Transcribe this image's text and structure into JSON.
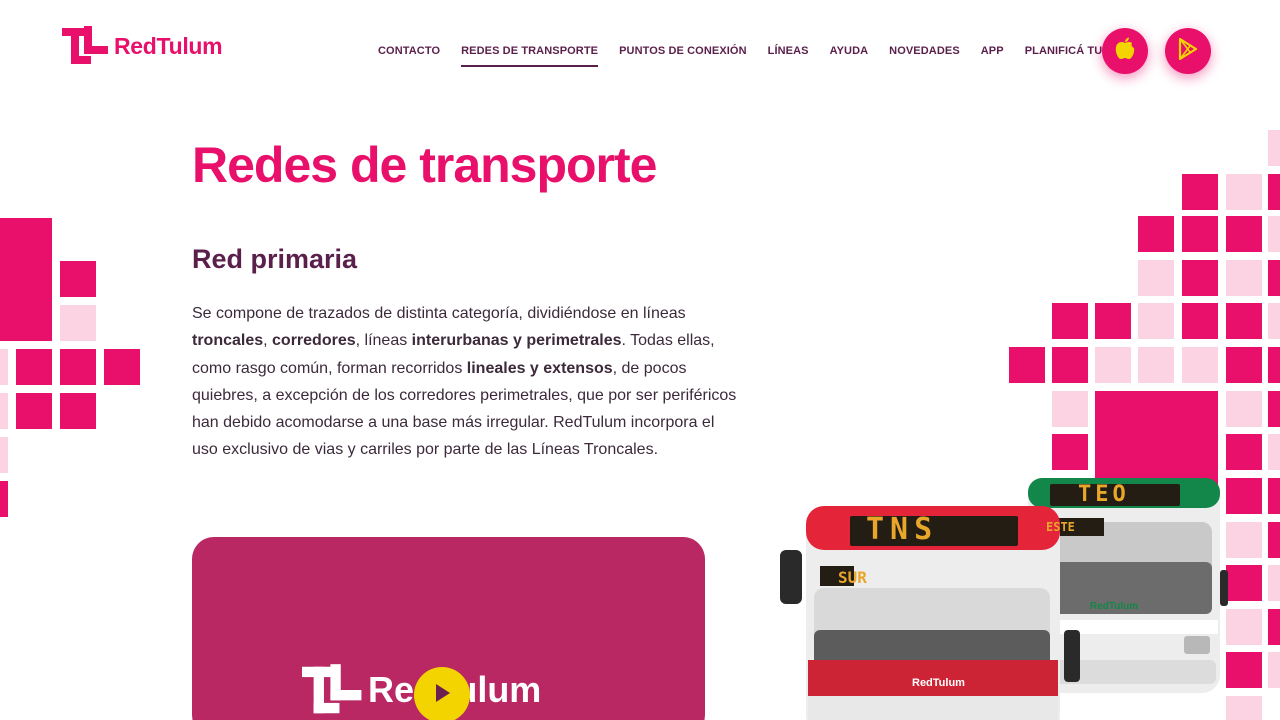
{
  "brand": {
    "name": "RedTulum",
    "accent": "#e8106a",
    "dark": "#5a1f4a"
  },
  "nav": {
    "items": [
      {
        "label": "CONTACTO",
        "active": false
      },
      {
        "label": "REDES DE TRANSPORTE",
        "active": true
      },
      {
        "label": "PUNTOS DE CONEXIÓN",
        "active": false
      },
      {
        "label": "LÍNEAS",
        "active": false
      },
      {
        "label": "AYUDA",
        "active": false
      },
      {
        "label": "NOVEDADES",
        "active": false
      },
      {
        "label": "APP",
        "active": false
      },
      {
        "label": "PLANIFICÁ TU VIAJE",
        "active": false
      }
    ]
  },
  "store_buttons": {
    "apple_icon": "apple-icon",
    "play_icon": "google-play-icon"
  },
  "page": {
    "title": "Redes de transporte",
    "section_title": "Red primaria",
    "paragraph": [
      {
        "text": "Se compone de trazados de distinta categoría, dividiéndose en líneas ",
        "bold": false
      },
      {
        "text": "troncales",
        "bold": true
      },
      {
        "text": ", ",
        "bold": false
      },
      {
        "text": "corredores",
        "bold": true
      },
      {
        "text": ", líneas ",
        "bold": false
      },
      {
        "text": "interurbanas y perimetrales",
        "bold": true
      },
      {
        "text": ". Todas ellas, como rasgo común, forman recorridos ",
        "bold": false
      },
      {
        "text": "lineales y extensos",
        "bold": true
      },
      {
        "text": ", de pocos quiebres, a excepción de los corredores perimetrales, que por ser periféricos han debido acomodarse a una base más irregular. RedTulum incorpora el uso exclusivo de vias y carriles por parte de las Líneas Troncales.",
        "bold": false
      }
    ]
  },
  "video": {
    "logo_text": "RedTulum",
    "play_icon": "play-icon"
  },
  "buses": {
    "front": {
      "route": "TNS",
      "direction": "SUR",
      "brand": "RedTulum"
    },
    "back": {
      "route": "TEO",
      "direction": "ESTE",
      "brand": "RedTulum"
    }
  }
}
